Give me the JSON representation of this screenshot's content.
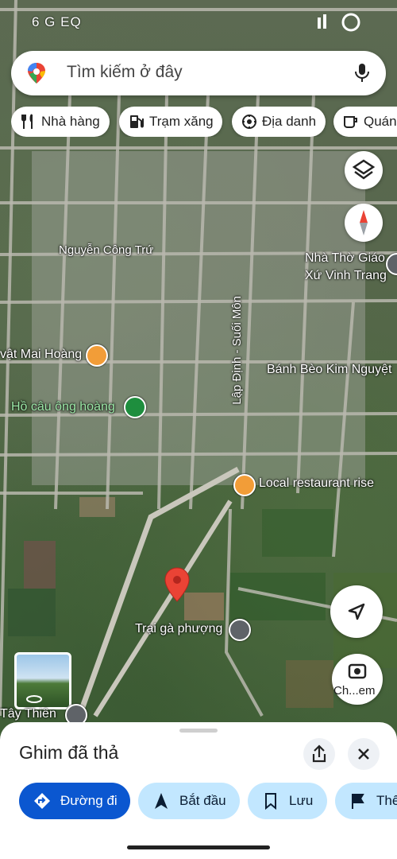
{
  "status": {
    "left_text": "6 G EQ"
  },
  "search": {
    "placeholder": "Tìm kiếm ở đây",
    "pin_icon": "maps-pin-icon",
    "mic_icon": "mic-icon"
  },
  "chips": [
    {
      "label": "Nhà hàng",
      "icon": "restaurant-icon"
    },
    {
      "label": "Trạm xăng",
      "icon": "gas-station-icon"
    },
    {
      "label": "Địa danh",
      "icon": "landmark-icon"
    },
    {
      "label": "Quán",
      "icon": "cafe-icon"
    }
  ],
  "map_labels": {
    "nguyen_cong_tru": "Nguyễn Công Trứ",
    "nha_tho": "Nhà Thờ Giáo Xứ Vinh Trang",
    "nha_tho_line1": "Nhà Thờ Giáo",
    "nha_tho_line2": "Xứ Vinh Trang",
    "lap_dinh": "Lập Định - Suối Môn",
    "mai_hoang": "vật Mai Hoàng",
    "banh_beo": "Bánh Bèo Kim Nguyệt",
    "ho_cau": "Hồ câu ông hoàng",
    "local_restaurant": "Local restaurant rise",
    "trai_ga": "Trại gà phượng",
    "tay_thien": "Tây Thiên",
    "ch_em": "Ch...em"
  },
  "sheet": {
    "title": "Ghim đã thả",
    "share_icon": "share-icon",
    "close_icon": "close-icon",
    "actions": [
      {
        "label": "Đường đi",
        "icon": "directions-icon",
        "primary": true
      },
      {
        "label": "Bắt đầu",
        "icon": "navigation-arrow-icon",
        "primary": false
      },
      {
        "label": "Lưu",
        "icon": "bookmark-icon",
        "primary": false
      },
      {
        "label": "Thê",
        "icon": "flag-icon",
        "primary": false
      }
    ]
  },
  "colors": {
    "primary_pill": "#0b57d0",
    "secondary_pill": "#c2e7ff",
    "pin_red": "#ea4335",
    "poi_orange": "#f29d38",
    "poi_green": "#1e8e3e"
  }
}
